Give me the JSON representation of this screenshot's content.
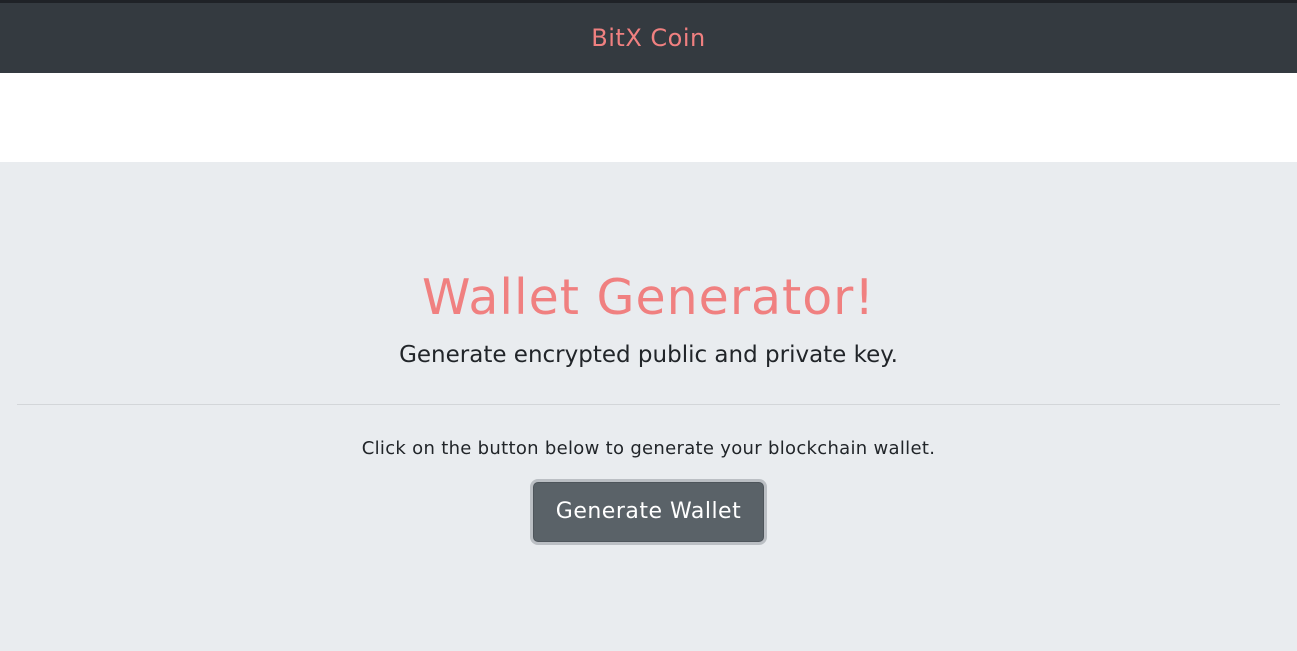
{
  "navbar": {
    "brand": "BitX Coin"
  },
  "jumbotron": {
    "title": "Wallet Generator!",
    "lead": "Generate encrypted public and private key.",
    "instruction": "Click on the button below to generate your blockchain wallet.",
    "button_label": "Generate Wallet"
  },
  "colors": {
    "accent": "#f08080",
    "navbar_bg": "#343a40",
    "jumbotron_bg": "#e9ecef",
    "button_bg": "#5a6268"
  }
}
